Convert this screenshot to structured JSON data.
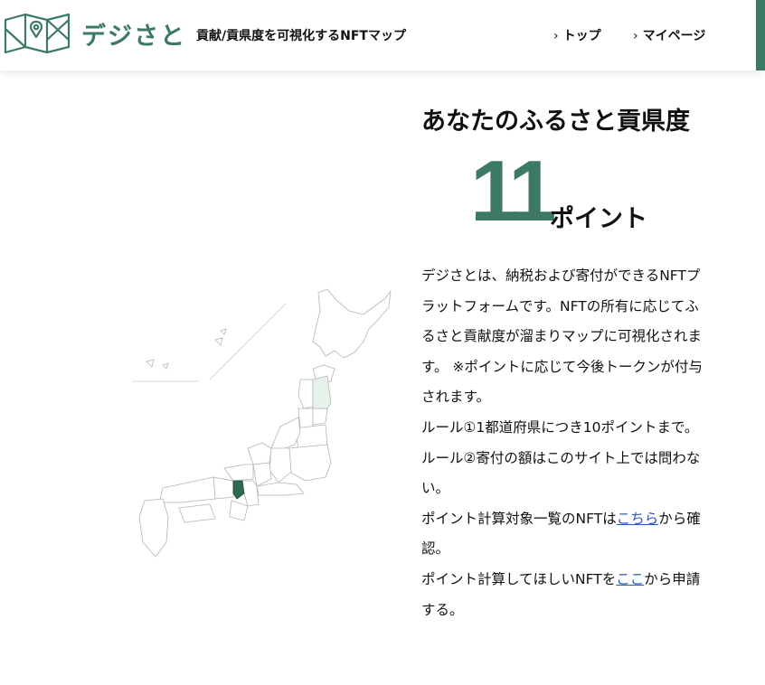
{
  "header": {
    "brand": "デジさと",
    "tagline": "貢献/貢県度を可視化するNFTマップ",
    "nav": [
      {
        "label": "トップ"
      },
      {
        "label": "マイページ"
      }
    ]
  },
  "main": {
    "title": "あなたのふるさと貢県度",
    "score": "11",
    "score_unit": "ポイント",
    "description": "デジさとは、納税および寄付ができるNFTプラットフォームです。NFTの所有に応じてふるさと貢献度が溜まりマップに可視化されます。 ※ポイントに応じて今後トークンが付与されます。",
    "rule1": "ルール①1都道府県につき10ポイントまで。",
    "rule2": "ルール②寄付の額はこのサイト上では問わない。",
    "list_prefix": "ポイント計算対象一覧のNFTは",
    "list_link": "こちら",
    "list_suffix": "から確認。",
    "apply_prefix": "ポイント計算してほしいNFTを",
    "apply_link": "ここ",
    "apply_suffix": "から申請する。"
  },
  "colors": {
    "accent": "#3d7a63",
    "highlight_light": "#e6f2ea",
    "highlight_dark": "#2f6a50",
    "link": "#2b5bb5"
  }
}
